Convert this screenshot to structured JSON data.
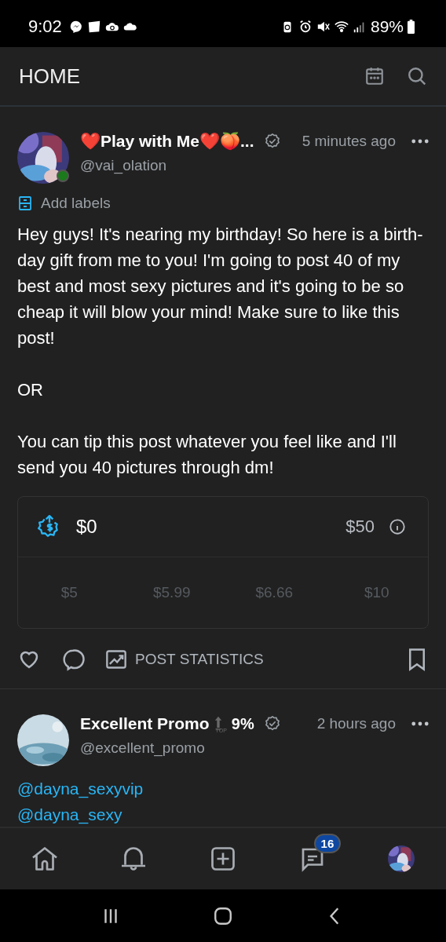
{
  "status_bar": {
    "time": "9:02",
    "battery": "89%"
  },
  "header": {
    "title": "HOME"
  },
  "posts": [
    {
      "author": "❤️Play with Me❤️🍑...",
      "handle": "@vai_olation",
      "online": true,
      "verified": true,
      "time": "5 minutes ago",
      "labels_link": "Add labels",
      "paragraphs": [
        {
          "kind": "text",
          "text": "Hey guys! It's nearing my birthday! So here is a birth-day gift from me to you! I'm going to post 40 of my best and most sexy pictures and it's going to be so cheap it will blow your mind! Make sure to like this post!"
        },
        {
          "kind": "text",
          "text": "OR"
        },
        {
          "kind": "text",
          "text": "You can tip this post whatever you feel like and I'll send you 40 pictures through dm!"
        }
      ],
      "tip": {
        "raised": "$0",
        "goal": "$50",
        "amounts": [
          "$5",
          "$5.99",
          "$6.66",
          "$10"
        ]
      },
      "stats_button": "POST STATISTICS"
    },
    {
      "author": "Excellent Promo",
      "rank": "9%",
      "rank_label": "TOP",
      "handle": "@excellent_promo",
      "online": false,
      "verified": true,
      "time": "2 hours ago",
      "paragraphs": [
        {
          "kind": "mention",
          "text": "@dayna_sexyvip"
        },
        {
          "kind": "mention",
          "text": "@dayna_sexy"
        }
      ]
    }
  ],
  "bottom_nav": [
    {
      "kind": "home"
    },
    {
      "kind": "bell"
    },
    {
      "kind": "add"
    },
    {
      "kind": "messages",
      "badge": "16"
    },
    {
      "kind": "avatar"
    }
  ]
}
